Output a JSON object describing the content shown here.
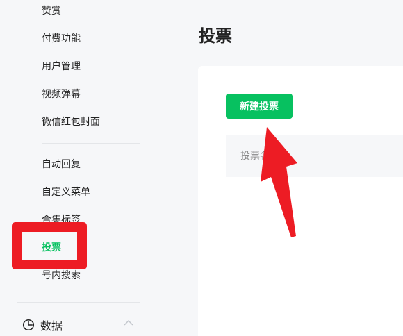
{
  "sidebar": {
    "items": [
      {
        "label": "赞赏"
      },
      {
        "label": "付费功能"
      },
      {
        "label": "用户管理"
      },
      {
        "label": "视频弹幕"
      },
      {
        "label": "微信红包封面"
      },
      {
        "label": "自动回复"
      },
      {
        "label": "自定义菜单"
      },
      {
        "label": "合集标签"
      },
      {
        "label": "投票"
      },
      {
        "label": "号内搜索"
      }
    ],
    "section": {
      "label": "数据"
    }
  },
  "main": {
    "title": "投票",
    "new_button_label": "新建投票",
    "table": {
      "first_column": "投票名称"
    }
  },
  "colors": {
    "accent": "#07c160",
    "annotation_red": "#ed1c24"
  },
  "icons": {
    "section_icon": "clock-pie-icon",
    "collapse_icon": "chevron-up-icon",
    "annotation_arrow": "red-arrow-icon"
  }
}
